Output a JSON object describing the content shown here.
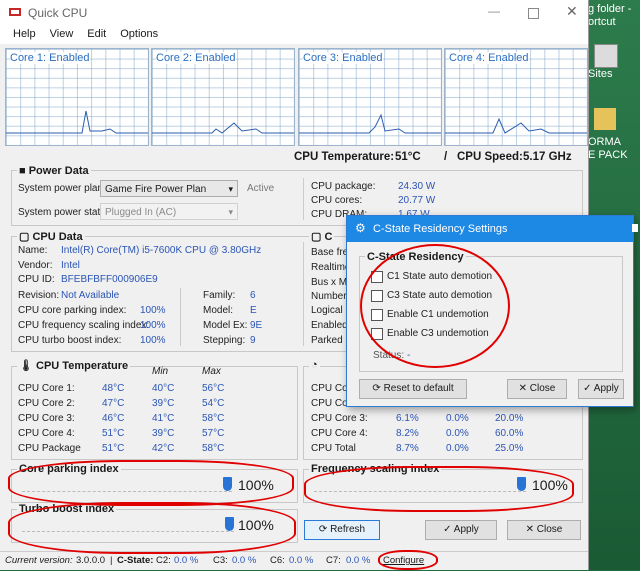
{
  "window": {
    "title": "Quick CPU"
  },
  "menu": [
    "Help",
    "View",
    "Edit",
    "Options"
  ],
  "cores": [
    {
      "label": "Core 1: Enabled"
    },
    {
      "label": "Core 2: Enabled"
    },
    {
      "label": "Core 3: Enabled"
    },
    {
      "label": "Core 4: Enabled"
    }
  ],
  "header": {
    "temp_label": "CPU Temperature:",
    "temp_value": "51°C",
    "speed_label": "CPU Speed:",
    "speed_value": "5.17 GHz",
    "divider": "/"
  },
  "power_data": {
    "title": "Power Data",
    "plan_label": "System power plan:",
    "plan_value": "Game Fire Power Plan",
    "plan_status": "Active",
    "state_label": "System power state:",
    "state_value": "Plugged In (AC)",
    "right": [
      {
        "label": "CPU package:",
        "value": "24.30 W"
      },
      {
        "label": "CPU cores:",
        "value": "20.77 W"
      },
      {
        "label": "CPU DRAM:",
        "value": "1.67 W"
      }
    ]
  },
  "cpu_data": {
    "title": "CPU Data",
    "name_label": "Name:",
    "name_value": "Intel(R) Core(TM) i5-7600K CPU @ 3.80GHz",
    "vendor_label": "Vendor:",
    "vendor_value": "Intel",
    "id_label": "CPU ID:",
    "id_value": "BFEBFBFF000906E9",
    "revision_label": "Revision:",
    "revision_value": "Not Available",
    "family_label": "Family:",
    "family_value": "6",
    "parking_label": "CPU core parking index:",
    "parking_value": "100%",
    "model_label": "Model:",
    "model_value": "E",
    "freq_label": "CPU frequency scaling index:",
    "freq_value": "100%",
    "modelex_label": "Model Ex:",
    "modelex_value": "9E",
    "turbo_label": "CPU turbo boost index:",
    "turbo_value": "100%",
    "stepping_label": "Stepping:",
    "stepping_value": "9",
    "right_title": "C",
    "right_labels": [
      "Base freq",
      "Realtime",
      "Bus x Mu",
      "Number c",
      "Logical p",
      "Enabled c",
      "Parked c"
    ]
  },
  "temperature": {
    "title": "CPU Temperature",
    "min_header": "Min",
    "max_header": "Max",
    "rows": [
      {
        "label": "CPU Core 1:",
        "cur": "48°C",
        "min": "40°C",
        "max": "56°C"
      },
      {
        "label": "CPU Core 2:",
        "cur": "47°C",
        "min": "39°C",
        "max": "54°C"
      },
      {
        "label": "CPU Core 3:",
        "cur": "46°C",
        "min": "41°C",
        "max": "58°C"
      },
      {
        "label": "CPU Core 4:",
        "cur": "51°C",
        "min": "39°C",
        "max": "57°C"
      },
      {
        "label": "CPU Package",
        "cur": "51°C",
        "min": "42°C",
        "max": "58°C"
      }
    ]
  },
  "cstate_table": {
    "rows": [
      {
        "label": "CPU Co",
        "a": "",
        "b": "",
        "c": ""
      },
      {
        "label": "CPU Co",
        "a": "",
        "b": "",
        "c": ""
      },
      {
        "label": "CPU Core 3:",
        "a": "6.1%",
        "b": "0.0%",
        "c": "20.0%"
      },
      {
        "label": "CPU Core 4:",
        "a": "8.2%",
        "b": "0.0%",
        "c": "60.0%"
      },
      {
        "label": "CPU Total",
        "a": "8.7%",
        "b": "0.0%",
        "c": "25.0%"
      }
    ]
  },
  "sliders": {
    "parking": {
      "title": "Core parking index",
      "value_text": "100%",
      "level": 1.0
    },
    "frequency": {
      "title": "Frequency scaling index",
      "value_text": "100%",
      "level": 1.0
    },
    "turbo": {
      "title": "Turbo boost index",
      "value_text": "100%",
      "level": 1.0
    }
  },
  "buttons": {
    "refresh": "Refresh",
    "apply": "Apply",
    "close": "Close",
    "configure": "Configure"
  },
  "status": {
    "version_label": "Current version:",
    "version_value": "3.0.0.0",
    "cstate_label": "C-State:",
    "c2_label": "C2:",
    "c2_value": "0.0 %",
    "c3_label": "C3:",
    "c3_value": "0.0 %",
    "c6_label": "C6:",
    "c6_value": "0.0 %",
    "c7_label": "C7:",
    "c7_value": "0.0 %"
  },
  "dialog": {
    "title": "C-State Residency Settings",
    "group_title": "C-State Residency",
    "options": [
      "C1 State auto demotion",
      "C3 State auto demotion",
      "Enable C1 undemotion",
      "Enable C3 undemotion"
    ],
    "status_label": "Status:",
    "status_value": "-",
    "reset_label": "Reset to default",
    "close_label": "Close",
    "apply_label": "Apply"
  },
  "desktop": {
    "lines": [
      "g folder -",
      "ortcut",
      "Sites",
      "ORMA",
      "E PACK"
    ]
  },
  "colors": {
    "accent": "#2b6fc0",
    "dialog_title": "#1e88e5",
    "annotation": "#e00000",
    "desktop": "#1f6b3e"
  }
}
